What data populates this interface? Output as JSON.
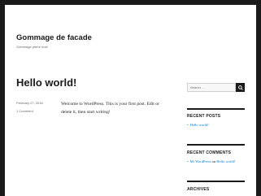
{
  "site": {
    "title": "Gommage de facade",
    "description": "Gommage pierre bois"
  },
  "post": {
    "title": "Hello world!",
    "date": "February 27, 2016",
    "comments": "1 Comment",
    "content": "Welcome to WordPress. This is your first post. Edit or delete it, then start writing!"
  },
  "sidebar": {
    "search": {
      "placeholder": "Search …"
    },
    "recent_posts": {
      "title": "RECENT POSTS",
      "items": [
        "Hello world!"
      ]
    },
    "recent_comments": {
      "title": "RECENT COMMENTS",
      "author": "Mr WordPress",
      "on": "on",
      "post": "Hello world!"
    },
    "archives": {
      "title": "ARCHIVES"
    }
  },
  "colors": {
    "frame": "#1a1a1a",
    "link": "#007acc",
    "text": "#1a1a1a",
    "muted": "#686868"
  }
}
